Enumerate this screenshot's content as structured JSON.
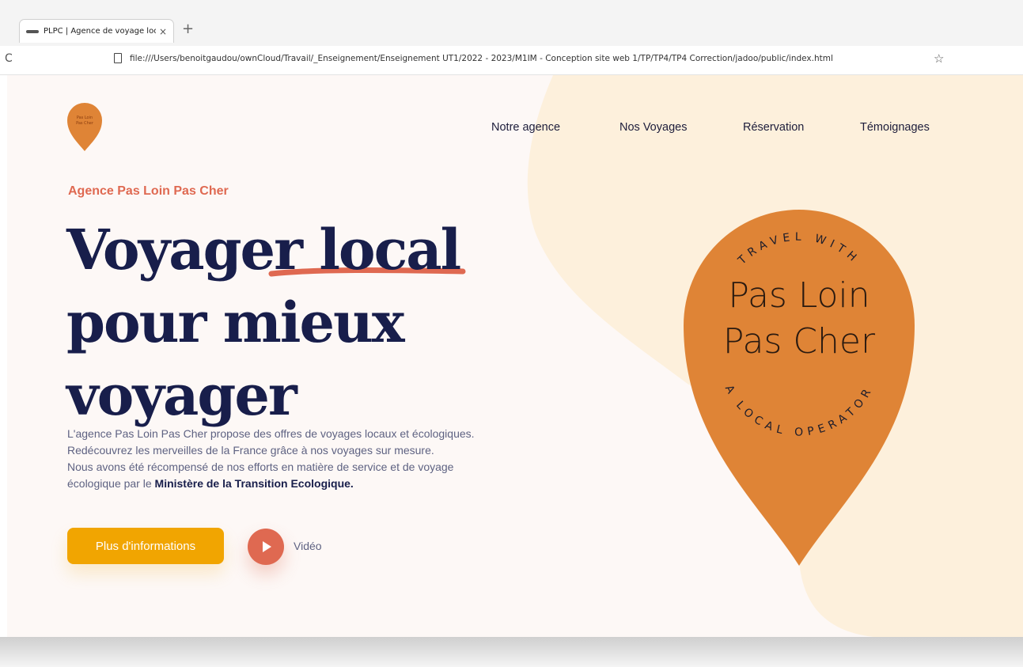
{
  "browser": {
    "tab_title": "PLPC | Agence de voyage local",
    "tab_close": "×",
    "new_tab": "+",
    "reload": "C",
    "url": "file:///Users/benoitgaudou/ownCloud/Travail/_Enseignement/Enseignement UT1/2022 - 2023/M1IM - Conception site web 1/TP/TP4/TP4 Correction/jadoo/public/index.html",
    "bookmark": "☆"
  },
  "logo": {
    "text_top": "Pas Loin",
    "text_bottom": "Pas Cher"
  },
  "nav": {
    "items": [
      {
        "label": "Notre agence"
      },
      {
        "label": "Nos Voyages"
      },
      {
        "label": "Réservation"
      },
      {
        "label": "Témoignages"
      }
    ]
  },
  "hero": {
    "subtitle": "Agence Pas Loin Pas Cher",
    "headline_a": "Voyager",
    "headline_b": "local",
    "headline_c": "pour mieux",
    "headline_d": "voyager",
    "desc_1": "L'agence Pas Loin Pas Cher propose des offres de voyages locaux et écologiques. Redécouvrez les merveilles de la France grâce à nos voyages sur mesure.",
    "desc_2_prefix": "Nous avons été récompensé de nos efforts en matière de service et de voyage écologique par le ",
    "desc_2_bold": "Ministère de la Transition Ecologique.",
    "cta_label": "Plus d'informations",
    "video_label": "Vidéo"
  },
  "badge": {
    "arc_top": "TRAVEL WITH",
    "line1": "Pas Loin",
    "line2": "Pas Cher",
    "arc_bottom": "A LOCAL OPERATOR"
  },
  "colors": {
    "accent_orange": "#df6951",
    "button_yellow": "#f1a501",
    "pin_orange": "#df8436",
    "navy": "#181e4b",
    "blob": "#fdf0dc",
    "page_bg": "#fdf8f6"
  }
}
